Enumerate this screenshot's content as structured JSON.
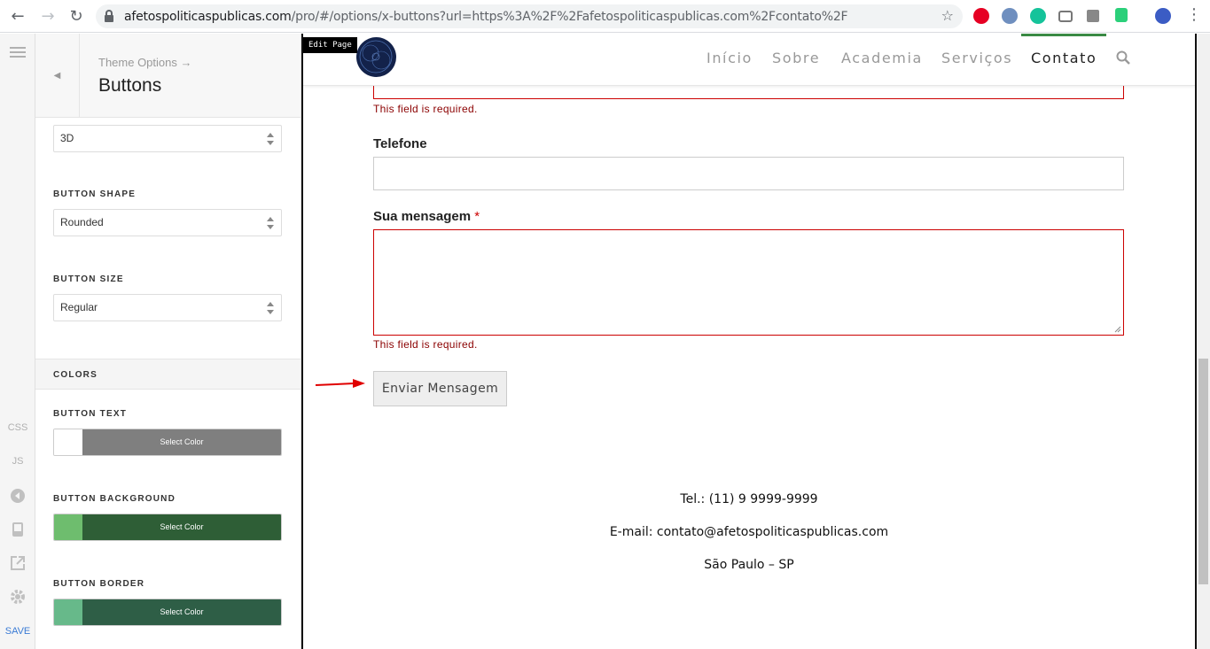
{
  "browser": {
    "url_host": "afetospoliticaspublicas.com",
    "url_path": "/pro/#/options/x-buttons?url=https%3A%2F%2Fafetospoliticaspublicas.com%2Fcontato%2F"
  },
  "rail": {
    "css_label": "CSS",
    "js_label": "JS",
    "save_label": "SAVE"
  },
  "panel": {
    "breadcrumb": "Theme Options →",
    "title": "Buttons",
    "style_value": "3D",
    "shape_label": "BUTTON SHAPE",
    "shape_value": "Rounded",
    "size_label": "BUTTON SIZE",
    "size_value": "Regular",
    "colors_section": "COLORS",
    "colors": [
      {
        "label": "BUTTON TEXT",
        "button": "Select Color",
        "swatch": "#ffffff",
        "bar": "#7f7f7f"
      },
      {
        "label": "BUTTON BACKGROUND",
        "button": "Select Color",
        "swatch": "#6ebd6e",
        "bar": "#2e5e36"
      },
      {
        "label": "BUTTON BORDER",
        "button": "Select Color",
        "swatch": "#67b98a",
        "bar": "#2e5e46"
      }
    ]
  },
  "preview": {
    "edit_page": "Edit Page",
    "nav": [
      "Início",
      "Sobre",
      "Academia",
      "Serviços",
      "Contato"
    ],
    "active_nav": "Contato",
    "accent": "#3a8a44",
    "error_color": "#b00000",
    "required_msg": "This field is required.",
    "phone_label": "Telefone",
    "message_label": "Sua mensagem",
    "required_star": "*",
    "submit_label": "Enviar Mensagem",
    "footer": {
      "phone": "Tel.: (11) 9 9999-9999",
      "email": "E-mail: contato@afetospoliticaspublicas.com",
      "city": "São Paulo – SP"
    }
  }
}
